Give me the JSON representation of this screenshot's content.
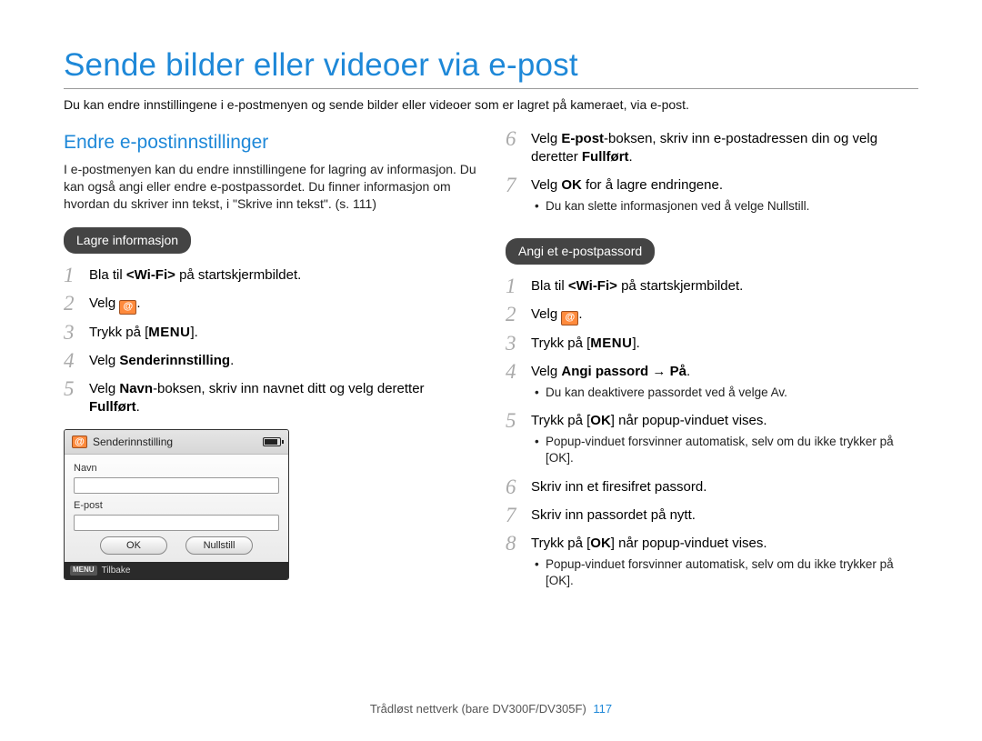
{
  "page_title": "Sende bilder eller videoer via e-post",
  "intro": "Du kan endre innstillingene i e-postmenyen og sende bilder eller videoer som er lagret på kameraet, via e-post.",
  "footer": {
    "text": "Trådløst nettverk (bare DV300F/DV305F)",
    "page_number": "117"
  },
  "left": {
    "heading": "Endre e-postinnstillinger",
    "intro": "I e-postmenyen kan du endre innstillingene for lagring av informasjon. Du kan også angi eller endre e-postpassordet. Du finner informasjon om hvordan du skriver inn tekst, i \"Skrive inn tekst\". (s. 111)",
    "pill": "Lagre informasjon",
    "steps": [
      {
        "num": "1",
        "pre": "Bla til ",
        "bold1": "<Wi-Fi>",
        "post": " på startskjermbildet."
      },
      {
        "num": "2",
        "pre": "Velg ",
        "icon": "email",
        "post": "."
      },
      {
        "num": "3",
        "pre": "Trykk på [",
        "menu": "MENU",
        "post": "]."
      },
      {
        "num": "4",
        "pre": "Velg ",
        "bold1": "Senderinnstilling",
        "post": "."
      },
      {
        "num": "5",
        "pre": "Velg ",
        "bold1": "Navn",
        "mid": "-boksen, skriv inn navnet ditt og velg deretter ",
        "bold2": "Fullført",
        "post": "."
      }
    ]
  },
  "device_panel": {
    "title": "Senderinnstilling",
    "field1": "Navn",
    "field2": "E-post",
    "btn_ok": "OK",
    "btn_reset": "Nullstill",
    "back_badge": "MENU",
    "back_text": "Tilbake"
  },
  "right": {
    "top_steps": [
      {
        "num": "6",
        "pre": "Velg ",
        "bold1": "E-post",
        "mid": "-boksen, skriv inn e-postadressen din og velg deretter ",
        "bold2": "Fullført",
        "post": "."
      },
      {
        "num": "7",
        "pre": "Velg ",
        "bold1": "OK",
        "post": " for å lagre endringene.",
        "sub": [
          "Du kan slette informasjonen ved å velge Nullstill."
        ]
      }
    ],
    "pill": "Angi et e-postpassord",
    "steps": [
      {
        "num": "1",
        "pre": "Bla til ",
        "bold1": "<Wi-Fi>",
        "post": " på startskjermbildet."
      },
      {
        "num": "2",
        "pre": "Velg ",
        "icon": "email",
        "post": "."
      },
      {
        "num": "3",
        "pre": "Trykk på [",
        "menu": "MENU",
        "post": "]."
      },
      {
        "num": "4",
        "pre": "Velg ",
        "bold1": "Angi passord",
        "arrow": " → ",
        "bold2": "På",
        "post": ".",
        "sub": [
          "Du kan deaktivere passordet ved å velge Av."
        ]
      },
      {
        "num": "5",
        "pre": "Trykk på [",
        "ok": "OK",
        "post": "] når popup-vinduet vises.",
        "sub": [
          "Popup-vinduet forsvinner automatisk, selv om du ikke trykker på [OK]."
        ]
      },
      {
        "num": "6",
        "pre": "Skriv inn et firesifret passord.",
        "post": ""
      },
      {
        "num": "7",
        "pre": "Skriv inn passordet på nytt.",
        "post": ""
      },
      {
        "num": "8",
        "pre": "Trykk på [",
        "ok": "OK",
        "post": "] når popup-vinduet vises.",
        "sub": [
          "Popup-vinduet forsvinner automatisk, selv om du ikke trykker på [OK]."
        ]
      }
    ]
  }
}
